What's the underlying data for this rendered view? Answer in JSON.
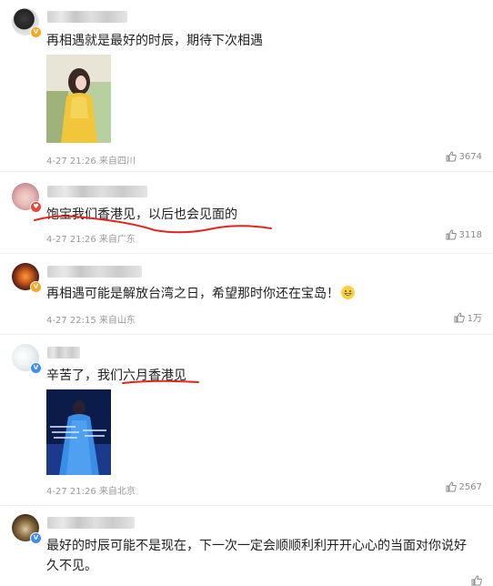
{
  "comments": [
    {
      "text": "再相遇就是最好的时辰，期待下次相遇",
      "time": "4-27 21:26",
      "location": "来自四川",
      "likes": "3674",
      "has_image": true,
      "badge": "gold"
    },
    {
      "text": "饱宝我们香港见，以后也会见面的",
      "time": "4-27 21:26",
      "location": "来自广东",
      "likes": "3118",
      "has_image": false,
      "badge": "red"
    },
    {
      "text": "再相遇可能是解放台湾之日，希望那时你还在宝岛！",
      "time": "4-27 22:15",
      "location": "来自山东",
      "likes": "1万",
      "has_image": false,
      "badge": "gold",
      "emoji": "grinning-face-emoji"
    },
    {
      "text": "辛苦了，我们六月香港见",
      "time": "4-27 21:26",
      "location": "来自北京",
      "likes": "2567",
      "has_image": true,
      "badge": "blue"
    },
    {
      "text_line1": "最好的时辰可能不是现在，下一次一定会顺顺利利开开心心的当面对你说好",
      "text_line2": "久不见。",
      "likes": "",
      "badge": "blue"
    }
  ],
  "icons": {
    "like": "thumbs-up-icon"
  },
  "colors": {
    "annotation_red": "#e0261f",
    "meta_gray": "#999999"
  }
}
